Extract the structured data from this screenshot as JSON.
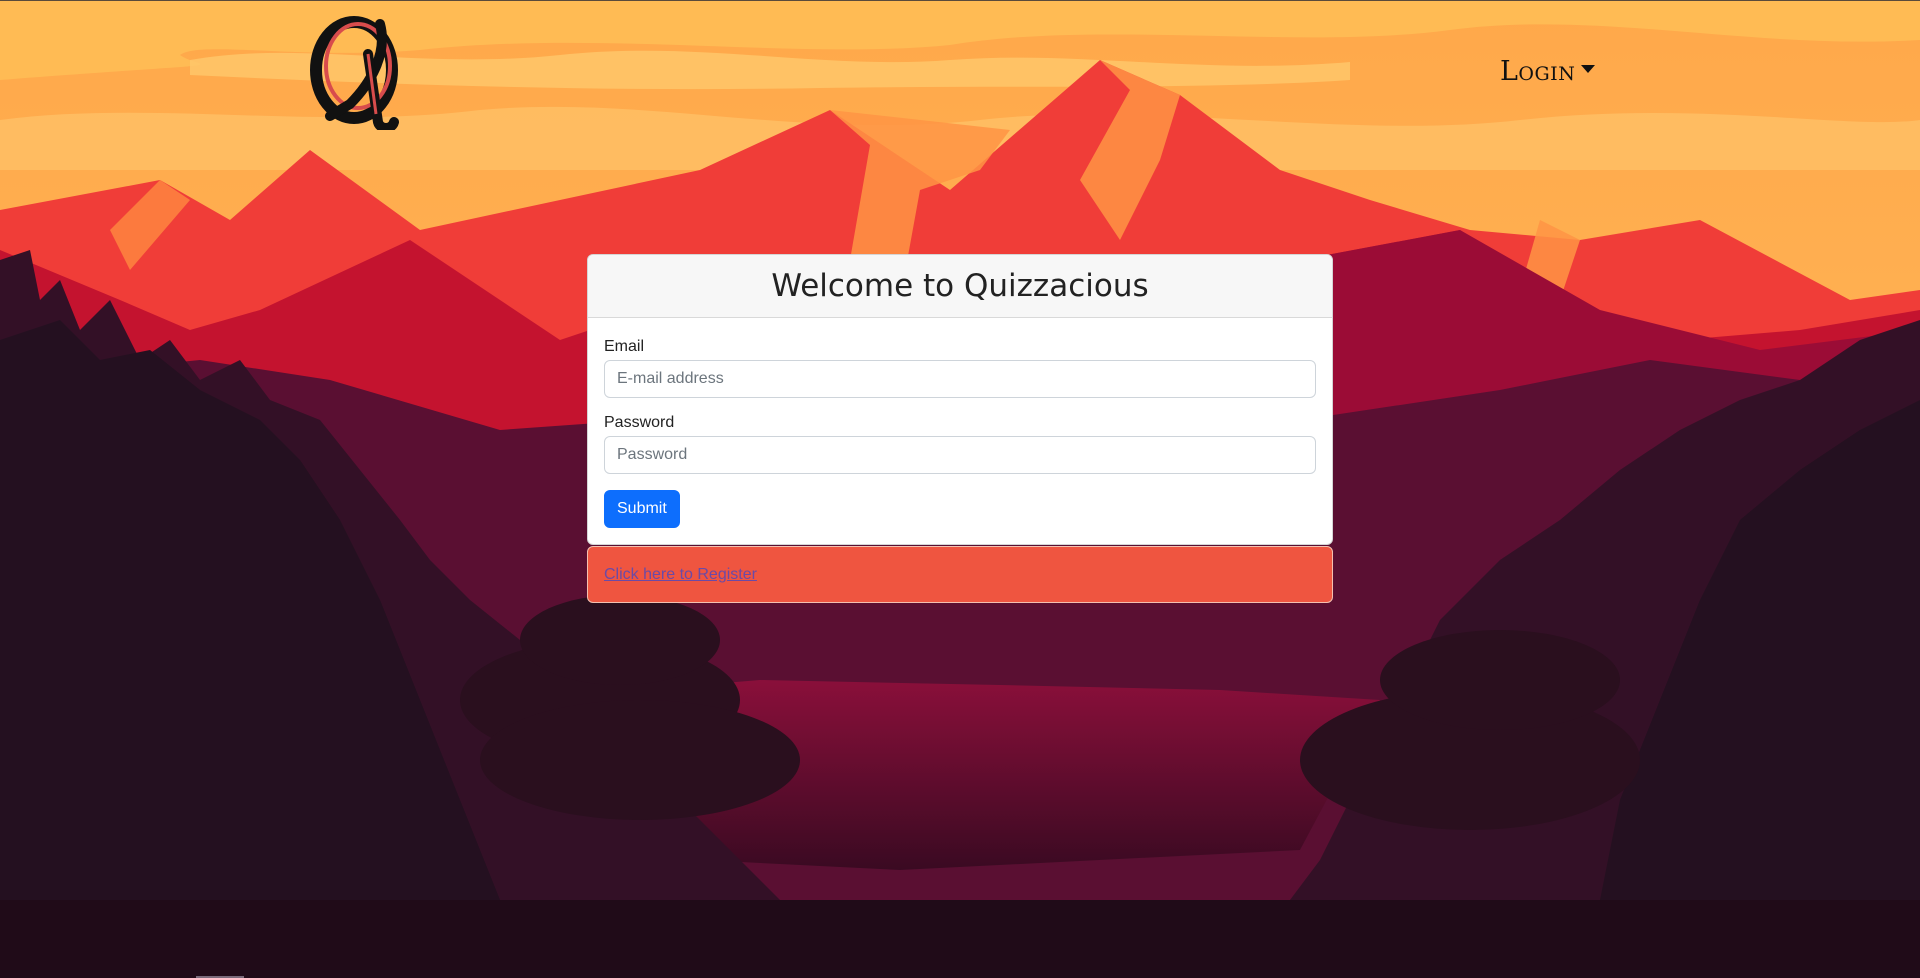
{
  "nav": {
    "login_label": "Login"
  },
  "card": {
    "title": "Welcome to Quizzacious",
    "email_label": "Email",
    "email_placeholder": "E-mail address",
    "password_label": "Password",
    "password_placeholder": "Password",
    "submit_label": "Submit"
  },
  "register": {
    "link_text": "Click here to Register"
  },
  "colors": {
    "primary_button": "#0d6efd",
    "register_bar": "#ef5540",
    "sky": "#ffb04a",
    "mountain_red": "#f03d38"
  }
}
